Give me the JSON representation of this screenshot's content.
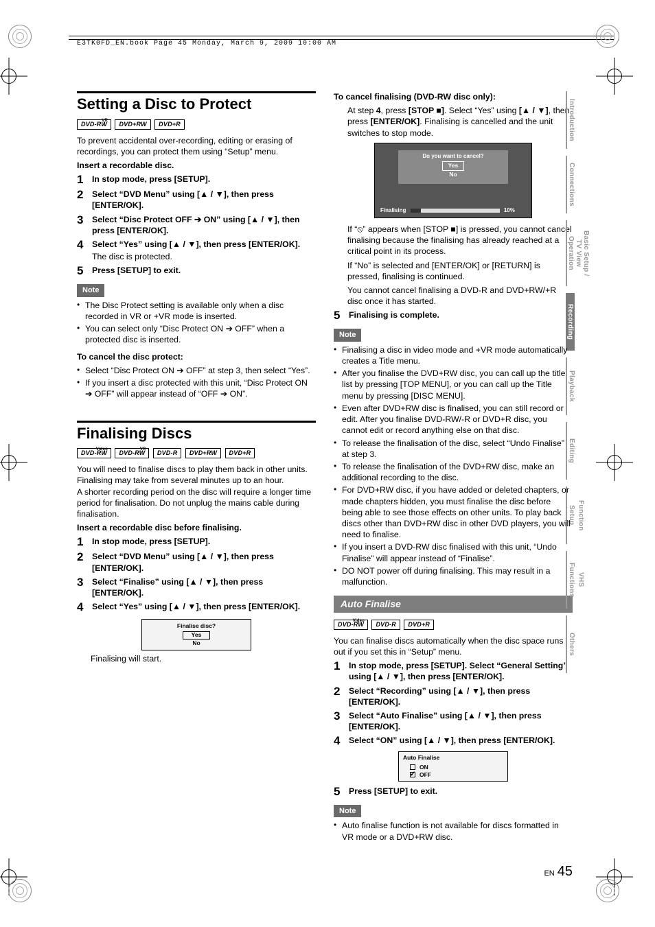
{
  "header_running": "E3TK0FD_EN.book  Page 45  Monday, March 9, 2009  10:00 AM",
  "page_lang": "EN",
  "page_number": "45",
  "tabs": [
    "Introduction",
    "Connections",
    "Basic Setup / TV View Operation",
    "Recording",
    "Playback",
    "Editing",
    "Function Setup",
    "VHS Functions",
    "Others"
  ],
  "section_protect": {
    "title": "Setting a Disc to Protect",
    "tags": [
      "DVD-RW",
      "DVD+RW",
      "DVD+R"
    ],
    "tag_sup": [
      "VR",
      "",
      ""
    ],
    "intro": "To prevent accidental over-recording, editing or erasing of recordings, you can protect them using “Setup” menu.",
    "lead": "Insert a recordable disc.",
    "steps": [
      "In stop mode, press [SETUP].",
      "Select “DVD Menu” using [▲ / ▼], then press [ENTER/OK].",
      "Select “Disc Protect OFF ➔ ON” using [▲ / ▼], then press [ENTER/OK].",
      "Select “Yes” using [▲ / ▼], then press [ENTER/OK].",
      "Press [SETUP] to exit."
    ],
    "step4_sub": "The disc is protected.",
    "note_label": "Note",
    "notes": [
      "The Disc Protect setting is available only when a disc recorded in VR or +VR mode is inserted.",
      "You can select only “Disc Protect ON ➔ OFF” when a protected disc is inserted."
    ],
    "cancel_h": "To cancel the disc protect:",
    "cancel": [
      "Select “Disc Protect ON ➔ OFF” at step 3, then select “Yes”.",
      "If you insert a disc protected with this unit, “Disc Protect ON ➔ OFF” will appear instead of “OFF ➔ ON”."
    ]
  },
  "section_finalise": {
    "title": "Finalising Discs",
    "tags": [
      "DVD-RW",
      "DVD-RW",
      "DVD-R",
      "DVD+RW",
      "DVD+R"
    ],
    "tag_sup": [
      "Video",
      "VR",
      "",
      "",
      ""
    ],
    "intro": "You will need to finalise discs to play them back in other units. Finalising may take from several minutes up to an hour.\nA shorter recording period on the disc will require a longer time period for finalisation. Do not unplug the mains cable during finalisation.",
    "lead": "Insert a recordable disc before finalising.",
    "steps": [
      "In stop mode, press [SETUP].",
      "Select “DVD Menu” using [▲ / ▼], then press [ENTER/OK].",
      "Select “Finalise” using [▲ / ▼], then press [ENTER/OK].",
      "Select “Yes” using [▲ / ▼], then press [ENTER/OK]."
    ],
    "osd": {
      "title": "Finalise disc?",
      "yes": "Yes",
      "no": "No"
    },
    "osd_after": "Finalising will start."
  },
  "right_col": {
    "cancel_h": "To cancel finalising (DVD-RW disc only):",
    "cancel_body_1": "At step ",
    "cancel_body_2": ", press ",
    "cancel_body_3": ". Select “Yes” using ",
    "cancel_body_4": ", then press ",
    "cancel_body_5": ". Finalising is cancelled and the unit switches to stop mode.",
    "step4_num": "4",
    "btn_stop": "[STOP ■]",
    "btn_arrows": "[▲ / ▼]",
    "btn_enter": "[ENTER/OK]",
    "btn_return": "[RETURN]",
    "osd_dark": {
      "q": "Do you want to cancel?",
      "yes": "Yes",
      "no": "No",
      "label": "Finalising",
      "pct": "10%"
    },
    "para_prohibit": "If “⦸” appears when [STOP ■] is pressed, you cannot cancel finalising because the finalising has already reached at a critical point in its process.",
    "para_no": "If “No” is selected and [ENTER/OK] or [RETURN] is pressed, finalising is continued.",
    "para_cant": "You cannot cancel finalising a DVD-R and DVD+RW/+R disc once it has started.",
    "step5": "Finalising is complete.",
    "note_label": "Note",
    "notes": [
      "Finalising a disc in video mode and +VR mode automatically creates a Title menu.",
      "After you finalise the DVD+RW disc, you can call up the title list by pressing [TOP MENU], or you can call up the Title menu by pressing [DISC MENU].",
      "Even after DVD+RW disc is finalised, you can still record or edit. After you finalise DVD-RW/-R or DVD+R disc, you cannot edit or record anything else on that disc.",
      "To release the finalisation of the disc, select “Undo Finalise” at step 3.",
      "To release the finalisation of the DVD+RW disc, make an additional recording to the disc.",
      "For DVD+RW disc, if you have added or deleted chapters, or made chapters hidden, you must finalise the disc before being able to see those effects on other units. To play back discs other than DVD+RW disc in other DVD players, you will need to finalise.",
      "If you insert a DVD-RW disc finalised with this unit, “Undo Finalise” will appear instead of “Finalise”.",
      "DO NOT power off during finalising. This may result in a malfunction."
    ]
  },
  "auto_finalise": {
    "heading": "Auto Finalise",
    "tags": [
      "DVD-RW",
      "DVD-R",
      "DVD+R"
    ],
    "tag_sup": [
      "Video",
      "",
      ""
    ],
    "intro": "You can finalise discs automatically when the disc space runs out if you set this in “Setup” menu.",
    "steps": [
      "In stop mode, press [SETUP]. Select “General Setting” using [▲ / ▼], then press [ENTER/OK].",
      "Select “Recording” using [▲ / ▼], then press [ENTER/OK].",
      "Select “Auto Finalise” using [▲ / ▼], then press [ENTER/OK].",
      "Select “ON” using [▲ / ▼], then press [ENTER/OK].",
      "Press [SETUP] to exit."
    ],
    "osd": {
      "title": "Auto Finalise",
      "on": "ON",
      "off": "OFF"
    },
    "note_label": "Note",
    "notes": [
      "Auto finalise function is not available for discs formatted in VR mode or a DVD+RW disc."
    ]
  }
}
